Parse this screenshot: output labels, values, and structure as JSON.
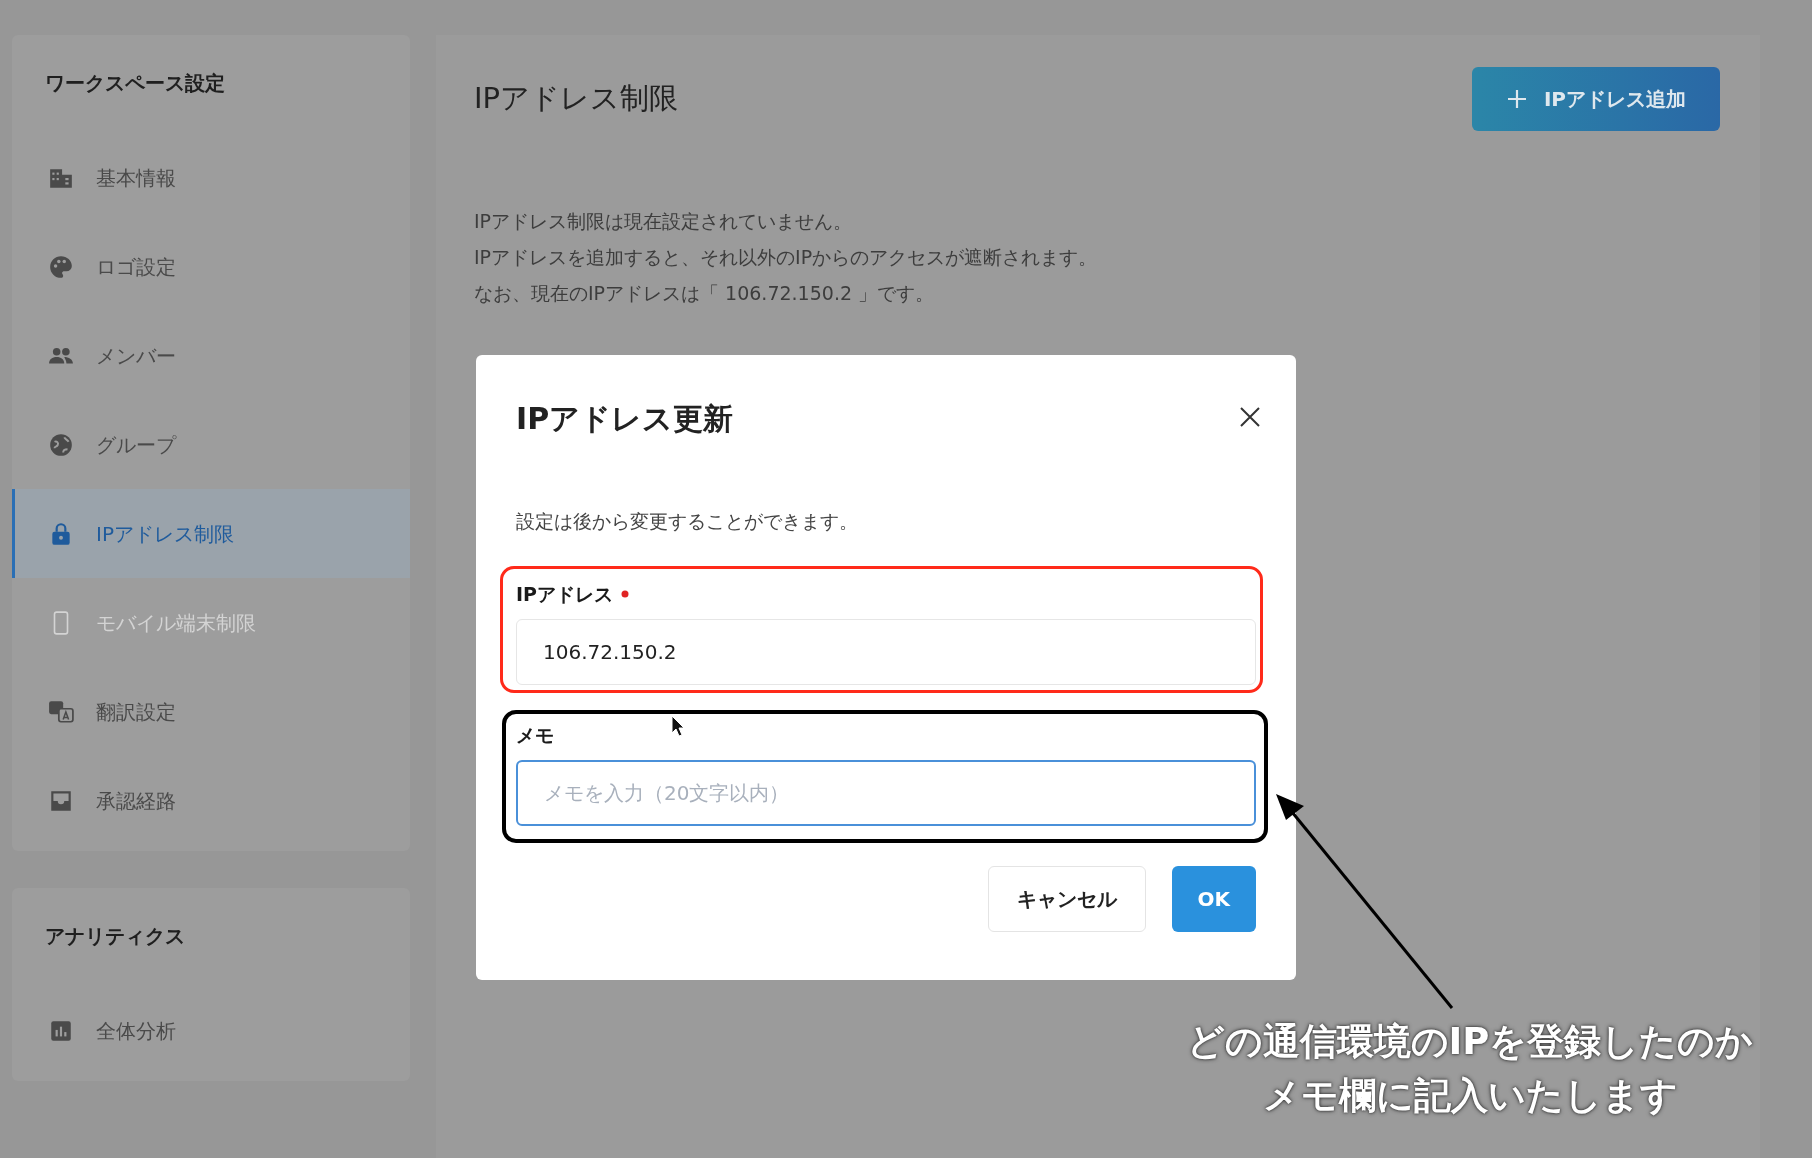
{
  "sidebar": {
    "sections": [
      {
        "title": "ワークスペース設定",
        "items": [
          {
            "label": "基本情報",
            "selected": false,
            "disabled": false
          },
          {
            "label": "ロゴ設定",
            "selected": false,
            "disabled": false
          },
          {
            "label": "メンバー",
            "selected": false,
            "disabled": false
          },
          {
            "label": "グループ",
            "selected": false,
            "disabled": false
          },
          {
            "label": "IPアドレス制限",
            "selected": true,
            "disabled": false
          },
          {
            "label": "モバイル端末制限",
            "selected": false,
            "disabled": true
          },
          {
            "label": "翻訳設定",
            "selected": false,
            "disabled": false
          },
          {
            "label": "承認経路",
            "selected": false,
            "disabled": false
          }
        ]
      },
      {
        "title": "アナリティクス",
        "items": [
          {
            "label": "全体分析",
            "selected": false,
            "disabled": false
          }
        ]
      }
    ]
  },
  "main": {
    "title": "IPアドレス制限",
    "add_button": "IPアドレス追加",
    "info_lines": [
      "IPアドレス制限は現在設定されていません。",
      "IPアドレスを追加すると、それ以外のIPからのアクセスが遮断されます。",
      "なお、現在のIPアドレスは「 106.72.150.2 」です。"
    ]
  },
  "dialog": {
    "title": "IPアドレス更新",
    "description": "設定は後から変更することができます。",
    "fields": [
      {
        "label": "IPアドレス",
        "required": true,
        "value": "106.72.150.2",
        "focused": false
      },
      {
        "label": "メモ",
        "required": false,
        "placeholder": "メモを入力（20文字以内）",
        "focused": true
      }
    ],
    "buttons": [
      {
        "label": "キャンセル",
        "kind": "secondary"
      },
      {
        "label": "OK",
        "kind": "primary"
      }
    ]
  },
  "annotation": {
    "lines": [
      "どの通信環境のIPを登録したのか",
      "メモ欄に記入いたします"
    ]
  }
}
